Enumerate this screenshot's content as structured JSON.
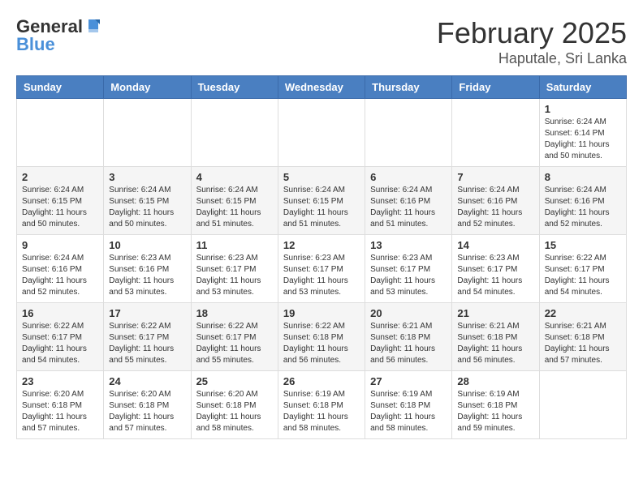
{
  "logo": {
    "general": "General",
    "blue": "Blue"
  },
  "title": {
    "month": "February 2025",
    "location": "Haputale, Sri Lanka"
  },
  "headers": [
    "Sunday",
    "Monday",
    "Tuesday",
    "Wednesday",
    "Thursday",
    "Friday",
    "Saturday"
  ],
  "weeks": [
    [
      {
        "day": "",
        "info": ""
      },
      {
        "day": "",
        "info": ""
      },
      {
        "day": "",
        "info": ""
      },
      {
        "day": "",
        "info": ""
      },
      {
        "day": "",
        "info": ""
      },
      {
        "day": "",
        "info": ""
      },
      {
        "day": "1",
        "info": "Sunrise: 6:24 AM\nSunset: 6:14 PM\nDaylight: 11 hours\nand 50 minutes."
      }
    ],
    [
      {
        "day": "2",
        "info": "Sunrise: 6:24 AM\nSunset: 6:15 PM\nDaylight: 11 hours\nand 50 minutes."
      },
      {
        "day": "3",
        "info": "Sunrise: 6:24 AM\nSunset: 6:15 PM\nDaylight: 11 hours\nand 50 minutes."
      },
      {
        "day": "4",
        "info": "Sunrise: 6:24 AM\nSunset: 6:15 PM\nDaylight: 11 hours\nand 51 minutes."
      },
      {
        "day": "5",
        "info": "Sunrise: 6:24 AM\nSunset: 6:15 PM\nDaylight: 11 hours\nand 51 minutes."
      },
      {
        "day": "6",
        "info": "Sunrise: 6:24 AM\nSunset: 6:16 PM\nDaylight: 11 hours\nand 51 minutes."
      },
      {
        "day": "7",
        "info": "Sunrise: 6:24 AM\nSunset: 6:16 PM\nDaylight: 11 hours\nand 52 minutes."
      },
      {
        "day": "8",
        "info": "Sunrise: 6:24 AM\nSunset: 6:16 PM\nDaylight: 11 hours\nand 52 minutes."
      }
    ],
    [
      {
        "day": "9",
        "info": "Sunrise: 6:24 AM\nSunset: 6:16 PM\nDaylight: 11 hours\nand 52 minutes."
      },
      {
        "day": "10",
        "info": "Sunrise: 6:23 AM\nSunset: 6:16 PM\nDaylight: 11 hours\nand 53 minutes."
      },
      {
        "day": "11",
        "info": "Sunrise: 6:23 AM\nSunset: 6:17 PM\nDaylight: 11 hours\nand 53 minutes."
      },
      {
        "day": "12",
        "info": "Sunrise: 6:23 AM\nSunset: 6:17 PM\nDaylight: 11 hours\nand 53 minutes."
      },
      {
        "day": "13",
        "info": "Sunrise: 6:23 AM\nSunset: 6:17 PM\nDaylight: 11 hours\nand 53 minutes."
      },
      {
        "day": "14",
        "info": "Sunrise: 6:23 AM\nSunset: 6:17 PM\nDaylight: 11 hours\nand 54 minutes."
      },
      {
        "day": "15",
        "info": "Sunrise: 6:22 AM\nSunset: 6:17 PM\nDaylight: 11 hours\nand 54 minutes."
      }
    ],
    [
      {
        "day": "16",
        "info": "Sunrise: 6:22 AM\nSunset: 6:17 PM\nDaylight: 11 hours\nand 54 minutes."
      },
      {
        "day": "17",
        "info": "Sunrise: 6:22 AM\nSunset: 6:17 PM\nDaylight: 11 hours\nand 55 minutes."
      },
      {
        "day": "18",
        "info": "Sunrise: 6:22 AM\nSunset: 6:17 PM\nDaylight: 11 hours\nand 55 minutes."
      },
      {
        "day": "19",
        "info": "Sunrise: 6:22 AM\nSunset: 6:18 PM\nDaylight: 11 hours\nand 56 minutes."
      },
      {
        "day": "20",
        "info": "Sunrise: 6:21 AM\nSunset: 6:18 PM\nDaylight: 11 hours\nand 56 minutes."
      },
      {
        "day": "21",
        "info": "Sunrise: 6:21 AM\nSunset: 6:18 PM\nDaylight: 11 hours\nand 56 minutes."
      },
      {
        "day": "22",
        "info": "Sunrise: 6:21 AM\nSunset: 6:18 PM\nDaylight: 11 hours\nand 57 minutes."
      }
    ],
    [
      {
        "day": "23",
        "info": "Sunrise: 6:20 AM\nSunset: 6:18 PM\nDaylight: 11 hours\nand 57 minutes."
      },
      {
        "day": "24",
        "info": "Sunrise: 6:20 AM\nSunset: 6:18 PM\nDaylight: 11 hours\nand 57 minutes."
      },
      {
        "day": "25",
        "info": "Sunrise: 6:20 AM\nSunset: 6:18 PM\nDaylight: 11 hours\nand 58 minutes."
      },
      {
        "day": "26",
        "info": "Sunrise: 6:19 AM\nSunset: 6:18 PM\nDaylight: 11 hours\nand 58 minutes."
      },
      {
        "day": "27",
        "info": "Sunrise: 6:19 AM\nSunset: 6:18 PM\nDaylight: 11 hours\nand 58 minutes."
      },
      {
        "day": "28",
        "info": "Sunrise: 6:19 AM\nSunset: 6:18 PM\nDaylight: 11 hours\nand 59 minutes."
      },
      {
        "day": "",
        "info": ""
      }
    ]
  ]
}
